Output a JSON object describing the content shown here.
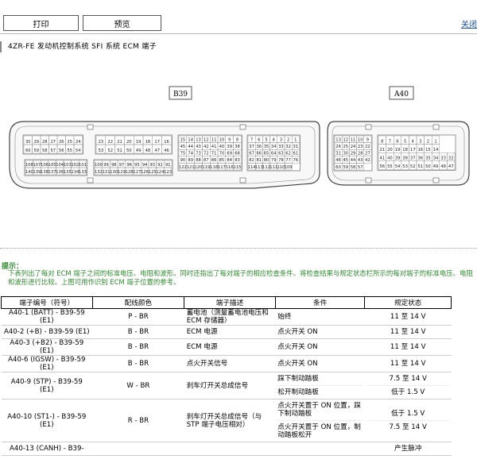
{
  "toolbar": {
    "print_label": "打印",
    "preview_label": "预览",
    "close_label": "关闭"
  },
  "section_title": "4ZR-FE 发动机控制系统 SFI 系统 ECM 端子",
  "diagram": {
    "b39_label": "B39",
    "a40_label": "A40",
    "b39_blocks": [
      {
        "rows": [
          [
            "30",
            "29",
            "28",
            "27",
            "26",
            "25",
            "24"
          ],
          [
            "60",
            "59",
            "58",
            "57",
            "56",
            "55",
            "54"
          ]
        ]
      },
      {
        "rows": [
          [
            "23",
            "22",
            "21",
            "20",
            "19",
            "18",
            "17",
            "16"
          ],
          [
            "53",
            "52",
            "51",
            "50",
            "49",
            "48",
            "47",
            "46"
          ]
        ]
      },
      {
        "rows": [
          [
            "15",
            "14",
            "13",
            "12",
            "11",
            "10",
            "9",
            "8"
          ],
          [
            "45",
            "44",
            "43",
            "42",
            "41",
            "40",
            "39",
            "38"
          ],
          [
            "75",
            "74",
            "73",
            "72",
            "71",
            "70",
            "69",
            "68"
          ],
          [
            "90",
            "89",
            "88",
            "87",
            "86",
            "85",
            "84",
            "83"
          ],
          [
            "122",
            "121",
            "120",
            "119",
            "118",
            "117",
            "116",
            "115"
          ]
        ]
      },
      {
        "rows": [
          [
            "7",
            "6",
            "5",
            "4",
            "3",
            "2",
            "1"
          ],
          [
            "37",
            "36",
            "35",
            "34",
            "33",
            "32",
            "31"
          ],
          [
            "67",
            "66",
            "65",
            "64",
            "63",
            "62",
            "61"
          ],
          [
            "82",
            "81",
            "80",
            "79",
            "78",
            "77",
            "76"
          ],
          [
            "114",
            "113",
            "112",
            "111",
            "110",
            "109"
          ]
        ]
      }
    ],
    "b39_lower_blocks": [
      {
        "rows": [
          [
            "108",
            "107",
            "106",
            "105",
            "104",
            "103",
            "102",
            "101"
          ],
          [
            "140",
            "139",
            "138",
            "137",
            "136",
            "135",
            "134",
            "133"
          ]
        ]
      },
      {
        "rows": [
          [
            "100",
            "99",
            "98",
            "97",
            "96",
            "95",
            "94",
            "93",
            "92",
            "91"
          ],
          [
            "132",
            "131",
            "130",
            "129",
            "128",
            "127",
            "126",
            "125",
            "124",
            "123"
          ]
        ]
      }
    ],
    "a40_blocks": [
      {
        "rows": [
          [
            "13",
            "12",
            "11",
            "10",
            "9"
          ],
          [
            "26",
            "25",
            "24",
            "23",
            "22"
          ],
          [
            "31",
            "30",
            "29",
            "28",
            "27"
          ],
          [
            "46",
            "45",
            "44",
            "43",
            "42"
          ],
          [
            "60",
            "59",
            "58",
            "57"
          ]
        ]
      },
      {
        "rows": [
          [
            "8",
            "7",
            "6",
            "5",
            "4",
            "3",
            "2",
            "1"
          ],
          [
            "21",
            "20",
            "19",
            "18",
            "17",
            "16",
            "15",
            "14"
          ],
          [
            "41",
            "40",
            "39",
            "38",
            "37",
            "36",
            "35",
            "34",
            "33",
            "32"
          ],
          [
            "56",
            "55",
            "54",
            "53",
            "52",
            "51",
            "50",
            "49",
            "48",
            "47"
          ]
        ]
      }
    ]
  },
  "hint": {
    "label": "提示：",
    "text": "下表列出了每对 ECM 端子之间的标准电压、电阻和波形。同时还指出了每对端子的相应检查条件。将检查结果与规定状态栏所示的每对端子的标准电压、电阻和波形进行比较。上图可用作识别 ECM 端子位置的参考。"
  },
  "table": {
    "headers": [
      "端子编号（符号）",
      "配线颜色",
      "端子描述",
      "条件",
      "规定状态"
    ],
    "rows": [
      {
        "terminal": "A40-1 (BATT) - B39-59 (E1)",
        "wire": "P - BR",
        "desc": "蓄电池（测量蓄电池电压和 ECM 存储器）",
        "cond": [
          "始终"
        ],
        "spec": [
          "11 至 14 V"
        ]
      },
      {
        "terminal": "A40-2 (+B) - B39-59 (E1)",
        "wire": "B - BR",
        "desc": "ECM 电源",
        "cond": [
          "点火开关 ON"
        ],
        "spec": [
          "11 至 14 V"
        ]
      },
      {
        "terminal": "A40-3 (+B2) - B39-59 (E1)",
        "wire": "B - BR",
        "desc": "ECM 电源",
        "cond": [
          "点火开关 ON"
        ],
        "spec": [
          "11 至 14 V"
        ]
      },
      {
        "terminal": "A40-6 (IGSW) - B39-59 (E1)",
        "wire": "B - BR",
        "desc": "点火开关信号",
        "cond": [
          "点火开关 ON"
        ],
        "spec": [
          "11 至 14 V"
        ]
      },
      {
        "terminal": "A40-9 (STP) - B39-59 (E1)",
        "wire": "W - BR",
        "desc": "刹车灯开关总成信号",
        "cond": [
          "踩下制动踏板",
          "松开制动踏板"
        ],
        "spec": [
          "7.5 至 14 V",
          "低于 1.5 V"
        ]
      },
      {
        "terminal": "A40-10 (ST1-) - B39-59 (E1)",
        "wire": "R - BR",
        "desc": "刹车灯开关总成信号（与 STP 端子电压相对）",
        "cond": [
          "点火开关置于 ON 位置，踩下制动踏板",
          "点火开关置于 ON 位置，制动踏板松开"
        ],
        "spec": [
          "低于 1.5 V",
          "7.5 至 14 V"
        ]
      },
      {
        "terminal": "A40-13 (CANH) - B39-",
        "wire": "",
        "desc": "",
        "cond": [
          ""
        ],
        "spec": [
          "产生脉冲"
        ]
      }
    ]
  }
}
